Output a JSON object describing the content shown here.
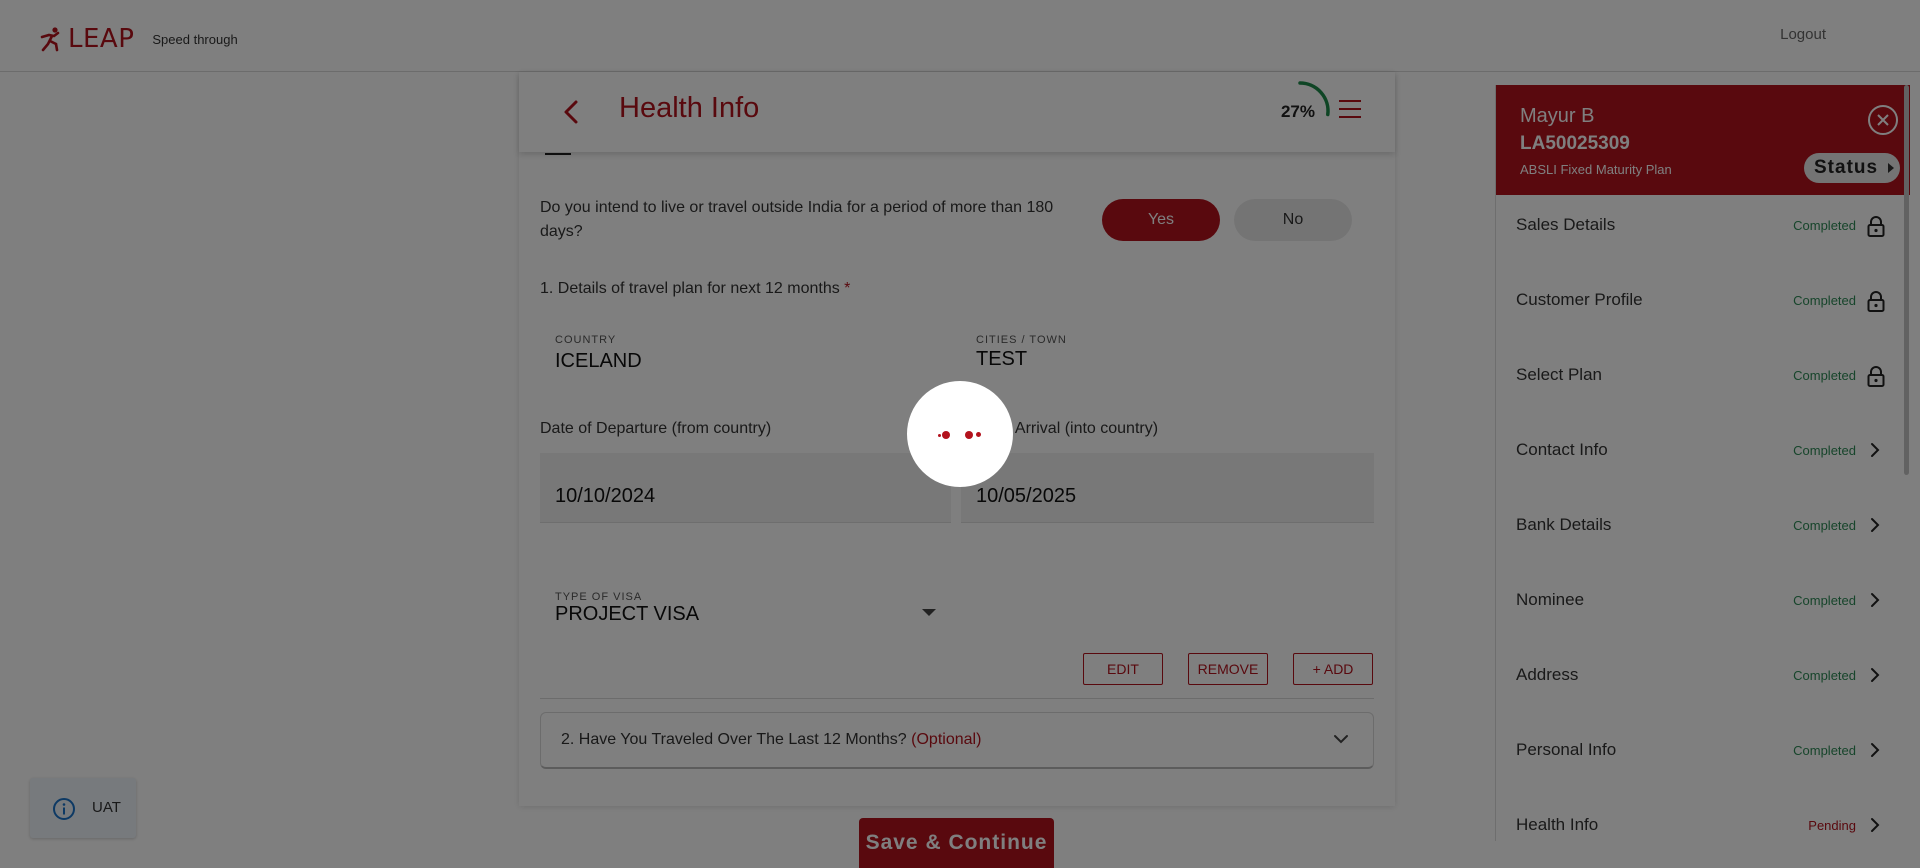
{
  "header": {
    "logo_text": "LEAP",
    "tagline": "Speed through",
    "logout_label": "Logout"
  },
  "page": {
    "title": "Health Info",
    "progress_label": "27%",
    "progress_value": 0.27
  },
  "travel": {
    "question": "Do you intend to live or travel outside India for a period of more than 180 days?",
    "yes_label": "Yes",
    "no_label": "No",
    "selected": "Yes",
    "section_label": "1. Details of travel plan for next 12 months",
    "required_mark": "*",
    "country_label": "COUNTRY",
    "country_value": "ICELAND",
    "cities_label": "CITIES / TOWN",
    "cities_value": "TEST",
    "departure_label": "Date of Departure (from country)",
    "departure_value": "10/10/2024",
    "arrival_label": "Date of Arrival (into country)",
    "arrival_label_visible": "of Arrival (into country)",
    "arrival_value": "10/05/2025",
    "visa_label": "TYPE OF VISA",
    "visa_value": "PROJECT VISA",
    "edit_label": "EDIT",
    "remove_label": "REMOVE",
    "add_label": "+ ADD"
  },
  "accordion": {
    "label": "2. Have You Traveled Over The Last 12 Months?",
    "optional_label": "(Optional)"
  },
  "save_label": "Save & Continue",
  "side_panel": {
    "name": "Mayur B",
    "app_id": "LA50025309",
    "plan": "ABSLI Fixed Maturity Plan",
    "status_label": "Status",
    "steps": [
      {
        "label": "Sales Details",
        "status": "Completed",
        "icon": "lock-icon"
      },
      {
        "label": "Customer Profile",
        "status": "Completed",
        "icon": "lock-icon"
      },
      {
        "label": "Select Plan",
        "status": "Completed",
        "icon": "lock-icon"
      },
      {
        "label": "Contact Info",
        "status": "Completed",
        "icon": "chevron-right-icon"
      },
      {
        "label": "Bank Details",
        "status": "Completed",
        "icon": "chevron-right-icon"
      },
      {
        "label": "Nominee",
        "status": "Completed",
        "icon": "chevron-right-icon"
      },
      {
        "label": "Address",
        "status": "Completed",
        "icon": "chevron-right-icon"
      },
      {
        "label": "Personal Info",
        "status": "Completed",
        "icon": "chevron-right-icon"
      },
      {
        "label": "Health Info",
        "status": "Pending",
        "icon": "chevron-right-icon"
      }
    ]
  },
  "env_badge": "UAT",
  "colors": {
    "brand": "#b3121d",
    "completed": "#2e8b57",
    "progress": "#1e8a4a"
  }
}
